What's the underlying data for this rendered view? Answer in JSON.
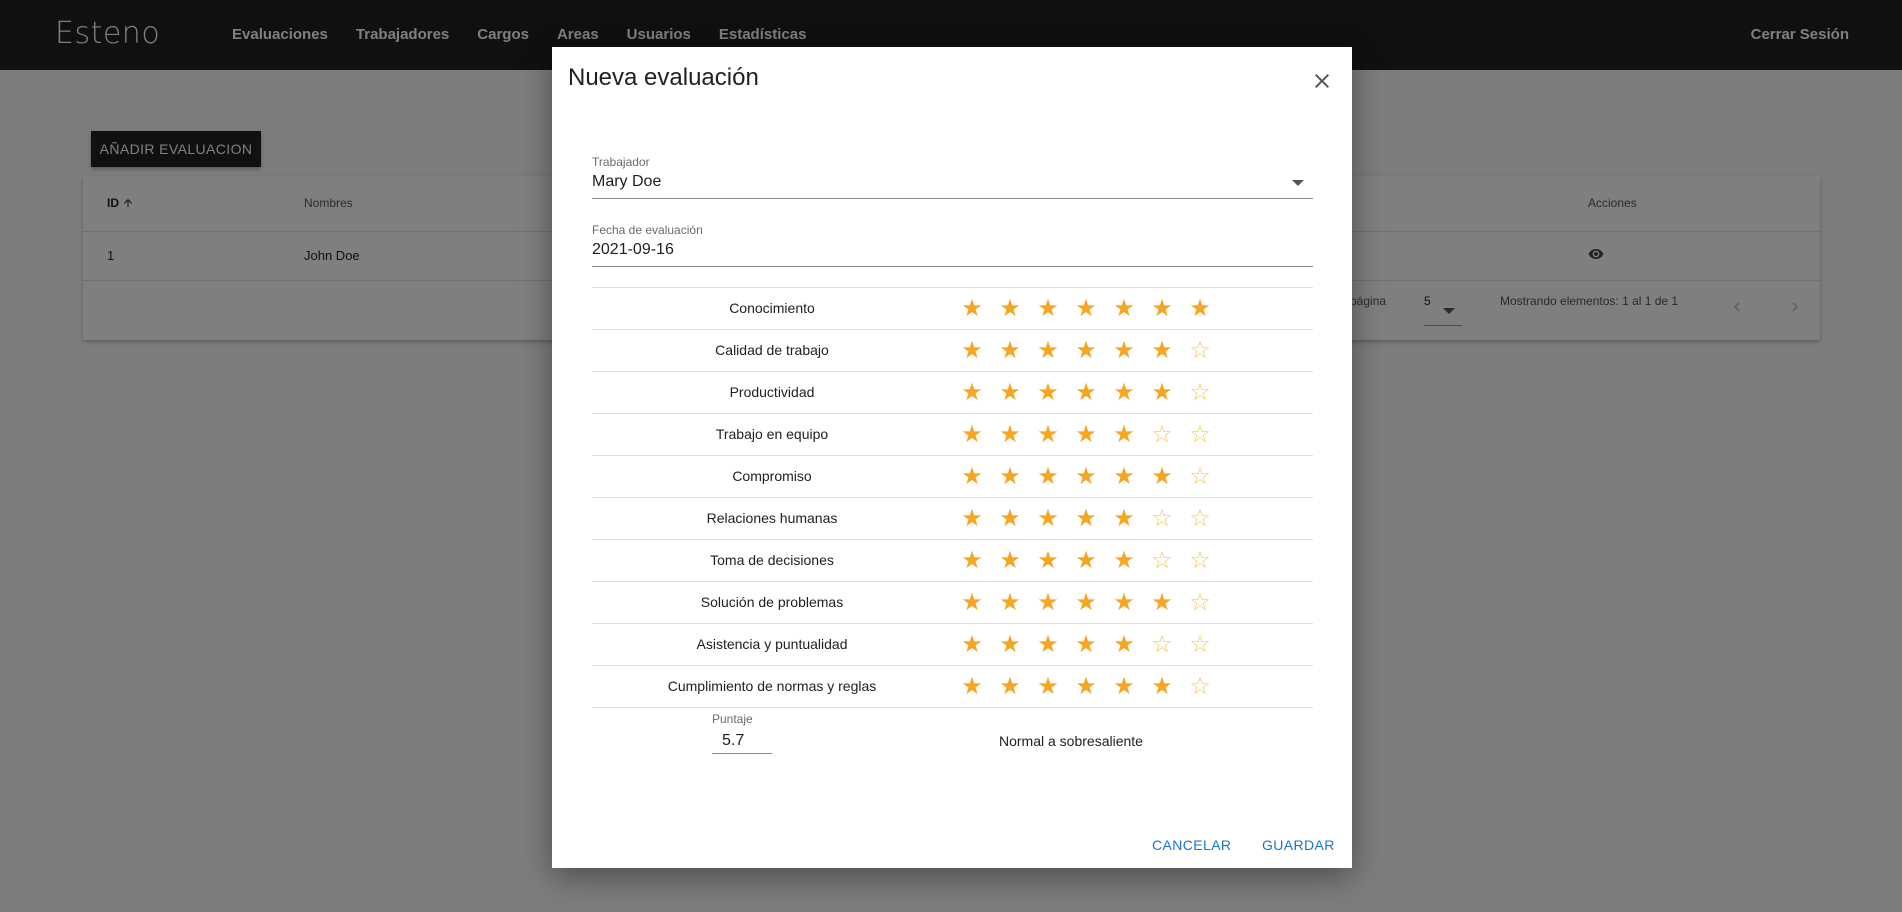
{
  "navbar": {
    "brand": "Esteno",
    "links": [
      "Evaluaciones",
      "Trabajadores",
      "Cargos",
      "Areas",
      "Usuarios",
      "Estadísticas"
    ],
    "logout": "Cerrar Sesión"
  },
  "page": {
    "add_button": "AÑADIR EVALUACION",
    "table": {
      "headers": {
        "id": "ID",
        "nombres": "Nombres",
        "acciones": "Acciones"
      },
      "rows": [
        {
          "id": "1",
          "nombres": "John Doe"
        }
      ],
      "pagination": {
        "rows_per_page_label": "página",
        "rows_per_page": "5",
        "showing": "Mostrando elementos: 1 al 1 de 1"
      }
    }
  },
  "dialog": {
    "title": "Nueva evaluación",
    "worker": {
      "label": "Trabajador",
      "value": "Mary Doe"
    },
    "date": {
      "label": "Fecha de evaluación",
      "value": "2021-09-16"
    },
    "max_stars": 7,
    "colors": {
      "star_full": "#F5A623",
      "star_empty": "#F8C84C",
      "accent": "#1976d2"
    },
    "criteria": [
      {
        "label": "Conocimiento",
        "rating": 7
      },
      {
        "label": "Calidad de trabajo",
        "rating": 6
      },
      {
        "label": "Productividad",
        "rating": 6
      },
      {
        "label": "Trabajo en equipo",
        "rating": 5
      },
      {
        "label": "Compromiso",
        "rating": 6
      },
      {
        "label": "Relaciones humanas",
        "rating": 5
      },
      {
        "label": "Toma de decisiones",
        "rating": 5
      },
      {
        "label": "Solución de problemas",
        "rating": 6
      },
      {
        "label": "Asistencia y puntualidad",
        "rating": 5
      },
      {
        "label": "Cumplimiento de normas y reglas",
        "rating": 6
      }
    ],
    "score": {
      "label": "Puntaje",
      "value": "5.7"
    },
    "category": "Normal a sobresaliente",
    "cancel": "CANCELAR",
    "save": "GUARDAR"
  }
}
